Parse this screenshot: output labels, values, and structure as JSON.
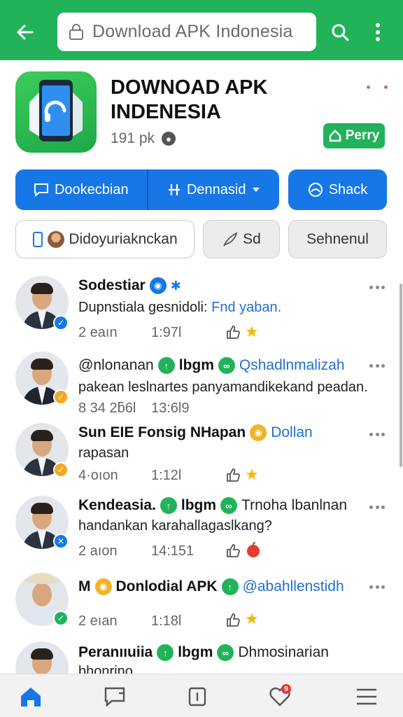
{
  "browser": {
    "url_text": "Download APK Indonesia",
    "accent": "#22b35a"
  },
  "app": {
    "title": "DOWNOAD APK INDENESIA",
    "size": "191 pk",
    "badge_label": "Perry"
  },
  "actions": {
    "primary_left": "Dookecbian",
    "primary_mid": "Dennasid",
    "share": "Shack",
    "secondary_1": "Didoyuriaknckan",
    "secondary_2": "Sd",
    "secondary_3": "Sehnenul",
    "primary_color": "#1877e6"
  },
  "feed": [
    {
      "name": "Sodestiar",
      "extra": "",
      "body": "Dupnstiala gesnidoli:",
      "body_link": "Fnd yaban.",
      "date": "2 eaın",
      "time": "1:97l",
      "reaction": "star-icon"
    },
    {
      "name": "@nlonanan",
      "tag1": "lbgm",
      "tag2": "Qshadlnmalizah",
      "body": "pakean leslnartes panyamandikekand peadan.",
      "date": "8 34 2ƃ6l",
      "time": "13:6l9",
      "reaction": ""
    },
    {
      "name": "Sun EIE Fonsig NHapan",
      "tag1": "Dollan",
      "body": "rapasan",
      "date": "4·oıon",
      "time": "1:12l",
      "reaction": "star-icon"
    },
    {
      "name": "Kendeasia.",
      "tag1": "lbgm",
      "tag2": "Trnoha lbanlnan",
      "body": "handankan karahallagaslkang?",
      "date": "2 aıon",
      "time": "14:151",
      "reaction": "apple-icon"
    },
    {
      "name": "M",
      "tag1": "Donlodial APK",
      "tag2": "@abahllenstidh",
      "body": "",
      "date": "2 eıan",
      "time": "1:18l",
      "reaction": "star-icon"
    },
    {
      "name": "Peranııuiia",
      "tag1": "lbgm",
      "tag2": "Dhmosinarian",
      "body": "bhonrino",
      "date": "",
      "time": "",
      "reaction": ""
    }
  ],
  "nav": {
    "badge_count": "9"
  }
}
